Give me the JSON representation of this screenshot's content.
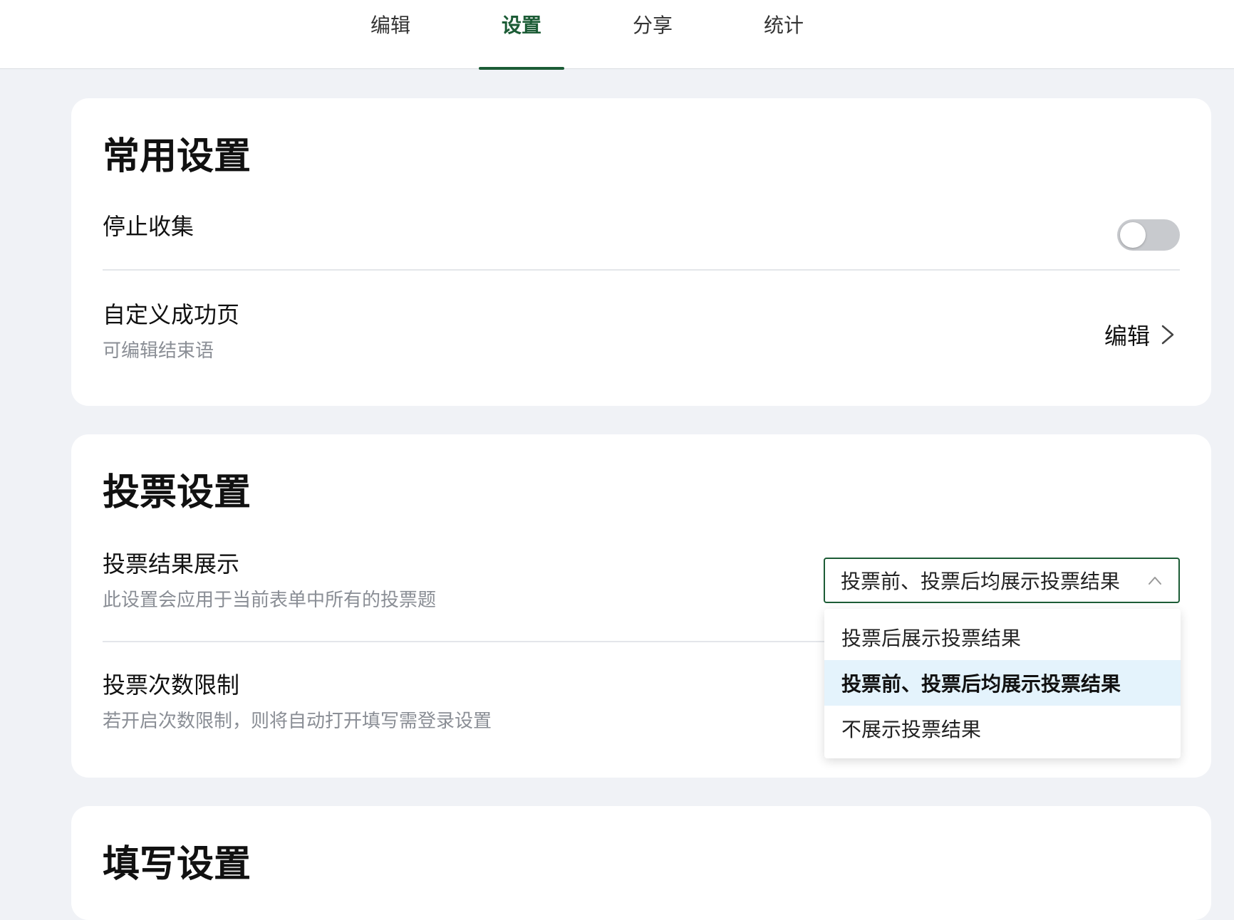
{
  "tabs": [
    {
      "label": "编辑"
    },
    {
      "label": "设置",
      "active": true
    },
    {
      "label": "分享"
    },
    {
      "label": "统计"
    }
  ],
  "accent_color": "#1c5c36",
  "common": {
    "title": "常用设置",
    "stop_collect": {
      "label": "停止收集",
      "enabled": false
    },
    "success_page": {
      "label": "自定义成功页",
      "sub": "可编辑结束语",
      "action": "编辑",
      "action_icon": "chevron-right-icon"
    }
  },
  "vote": {
    "title": "投票设置",
    "result_display": {
      "label": "投票结果展示",
      "sub": "此设置会应用于当前表单中所有的投票题",
      "selected": "投票前、投票后均展示投票结果",
      "options": [
        "投票后展示投票结果",
        "投票前、投票后均展示投票结果",
        "不展示投票结果"
      ]
    },
    "count_limit": {
      "label": "投票次数限制",
      "sub": "若开启次数限制，则将自动打开填写需登录设置"
    }
  },
  "fill": {
    "title": "填写设置"
  }
}
